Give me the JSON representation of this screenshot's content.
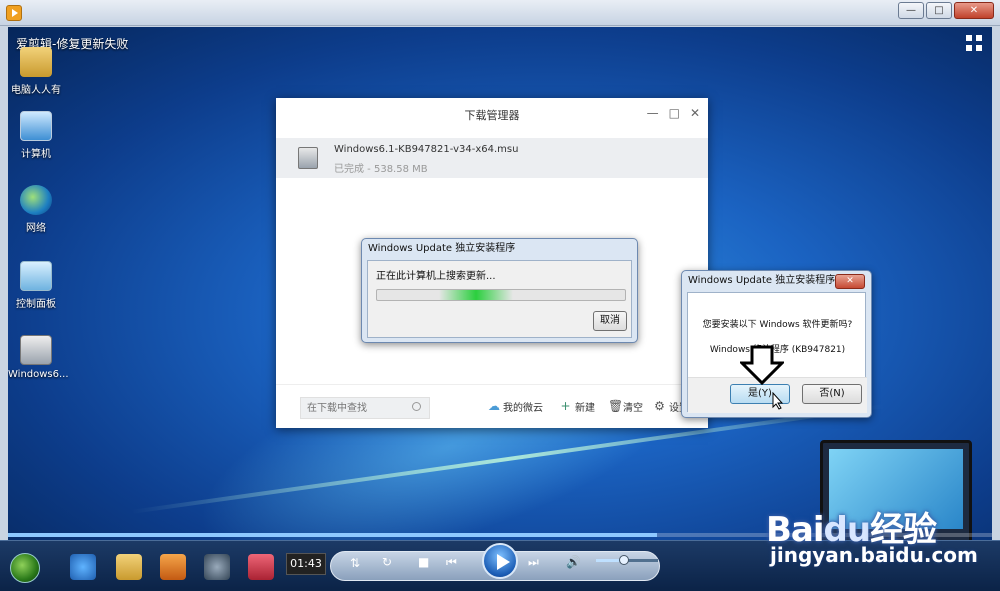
{
  "player": {
    "title": "爱剪辑-修复更新失败",
    "current_time": "01:43",
    "progress": 0.66,
    "volume": 0.45
  },
  "desktop_icons": [
    {
      "label": "电脑人人有",
      "icon": "user-folder-icon"
    },
    {
      "label": "计算机",
      "icon": "computer-icon"
    },
    {
      "label": "网络",
      "icon": "network-icon"
    },
    {
      "label": "控制面板",
      "icon": "control-panel-icon"
    },
    {
      "label": "Windows6...",
      "icon": "msu-file-icon"
    }
  ],
  "download_manager": {
    "title": "下载管理器",
    "item": {
      "filename": "Windows6.1-KB947821-v34-x64.msu",
      "status": "已完成 - 538.58 MB"
    },
    "search_placeholder": "在下载中查找",
    "tools": {
      "weiyun": "我的微云",
      "new": "新建",
      "clear": "清空",
      "settings": "设置"
    }
  },
  "update_dialog": {
    "title": "Windows Update 独立安装程序",
    "status": "正在此计算机上搜索更新...",
    "cancel": "取消",
    "search_progress": 0.25
  },
  "confirm_dialog": {
    "title": "Windows Update 独立安装程序",
    "question": "您要安装以下 Windows 软件更新吗?",
    "update_name": "Windows 修补程序 (KB947821)",
    "yes": "是(Y)",
    "no": "否(N)"
  },
  "watermark": {
    "logo": "Bai",
    "logo_paw": "du",
    "logo_text": "经验",
    "url": "jingyan.baidu.com"
  },
  "colors": {
    "desktop": "#1b63c2",
    "dialog_frame": "#dbe6f3",
    "accent": "#2bcf3e"
  }
}
